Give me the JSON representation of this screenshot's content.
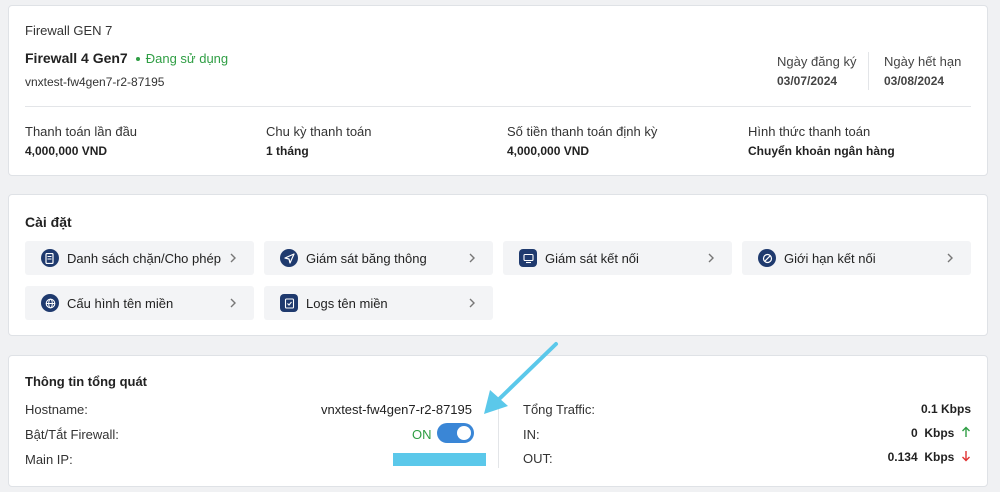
{
  "service": {
    "category": "Firewall GEN 7",
    "name": "Firewall 4 Gen7",
    "status": "Đang sử dụng",
    "hostname": "vnxtest-fw4gen7-r2-87195",
    "register_label": "Ngày đăng ký",
    "register_date": "03/07/2024",
    "expire_label": "Ngày hết hạn",
    "expire_date": "03/08/2024"
  },
  "billing": [
    {
      "label": "Thanh toán lần đầu",
      "value": "4,000,000 VND"
    },
    {
      "label": "Chu kỳ thanh toán",
      "value": "1 tháng"
    },
    {
      "label": "Số tiền thanh toán định kỳ",
      "value": "4,000,000 VND"
    },
    {
      "label": "Hình thức thanh toán",
      "value": "Chuyển khoản ngân hàng"
    }
  ],
  "settings": {
    "title": "Cài đặt",
    "items": [
      {
        "label": "Danh sách chặn/Cho phép",
        "icon": "list-doc-icon"
      },
      {
        "label": "Giám sát băng thông",
        "icon": "send-icon"
      },
      {
        "label": "Giám sát kết nối",
        "icon": "monitor-icon"
      },
      {
        "label": "Giới hạn kết nối",
        "icon": "block-icon"
      },
      {
        "label": "Cấu hình tên miền",
        "icon": "globe-icon"
      },
      {
        "label": "Logs tên miền",
        "icon": "checklist-icon"
      }
    ]
  },
  "overview": {
    "title": "Thông tin tổng quát",
    "hostname_label": "Hostname:",
    "hostname_value": "vnxtest-fw4gen7-r2-87195",
    "firewall_label": "Bật/Tắt Firewall:",
    "firewall_state": "ON",
    "mainip_label": "Main IP:",
    "traffic_label": "Tổng Traffic:",
    "traffic_value": "0.1 Kbps",
    "in_label": "IN:",
    "in_value": "0",
    "in_unit": "Kbps",
    "out_label": "OUT:",
    "out_value": "0.134",
    "out_unit": "Kbps"
  },
  "colors": {
    "accent": "#3a86d6",
    "status_green": "#2f9e44",
    "icon_navy": "#1f3a6e",
    "highlight": "#5bc8ea"
  }
}
